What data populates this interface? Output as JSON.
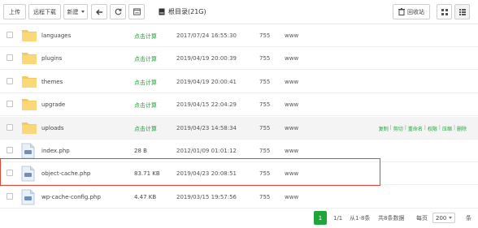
{
  "toolbar": {
    "upload_label": "上传",
    "remote_download_label": "远程下载",
    "new_label": "新建",
    "breadcrumb": "根目录(21G)",
    "recycle_bin_label": "回收站"
  },
  "files": [
    {
      "name": "languages",
      "type": "folder",
      "size": "点击计算",
      "size_clickable": true,
      "date": "2017/07/24 16:55:30",
      "perm": "755",
      "owner": "www"
    },
    {
      "name": "plugins",
      "type": "folder",
      "size": "点击计算",
      "size_clickable": true,
      "date": "2019/04/19 20:00:39",
      "perm": "755",
      "owner": "www"
    },
    {
      "name": "themes",
      "type": "folder",
      "size": "点击计算",
      "size_clickable": true,
      "date": "2019/04/19 20:00:41",
      "perm": "755",
      "owner": "www"
    },
    {
      "name": "upgrade",
      "type": "folder",
      "size": "点击计算",
      "size_clickable": true,
      "date": "2019/04/15 22:04:29",
      "perm": "755",
      "owner": "www"
    },
    {
      "name": "uploads",
      "type": "folder",
      "size": "点击计算",
      "size_clickable": true,
      "date": "2019/04/23 14:58:34",
      "perm": "755",
      "owner": "www",
      "ops": [
        "复制",
        "剪切",
        "重命名",
        "权限",
        "压缩",
        "删除"
      ]
    },
    {
      "name": "index.php",
      "type": "file",
      "size": "28 B",
      "size_clickable": false,
      "date": "2012/01/09 01:01:12",
      "perm": "755",
      "owner": "www"
    },
    {
      "name": "object-cache.php",
      "type": "file",
      "size": "83.71 KB",
      "size_clickable": false,
      "date": "2019/04/23 20:08:51",
      "perm": "755",
      "owner": "www"
    },
    {
      "name": "wp-cache-config.php",
      "type": "file",
      "size": "4.47 KB",
      "size_clickable": false,
      "date": "2019/03/15 19:57:56",
      "perm": "755",
      "owner": "www"
    }
  ],
  "pagination": {
    "current_page": "1",
    "page_count": "1/1",
    "range": "从1-8条",
    "total": "共8条数据",
    "per_page_label": "每页",
    "per_page_value": "200",
    "per_page_unit": "条"
  }
}
